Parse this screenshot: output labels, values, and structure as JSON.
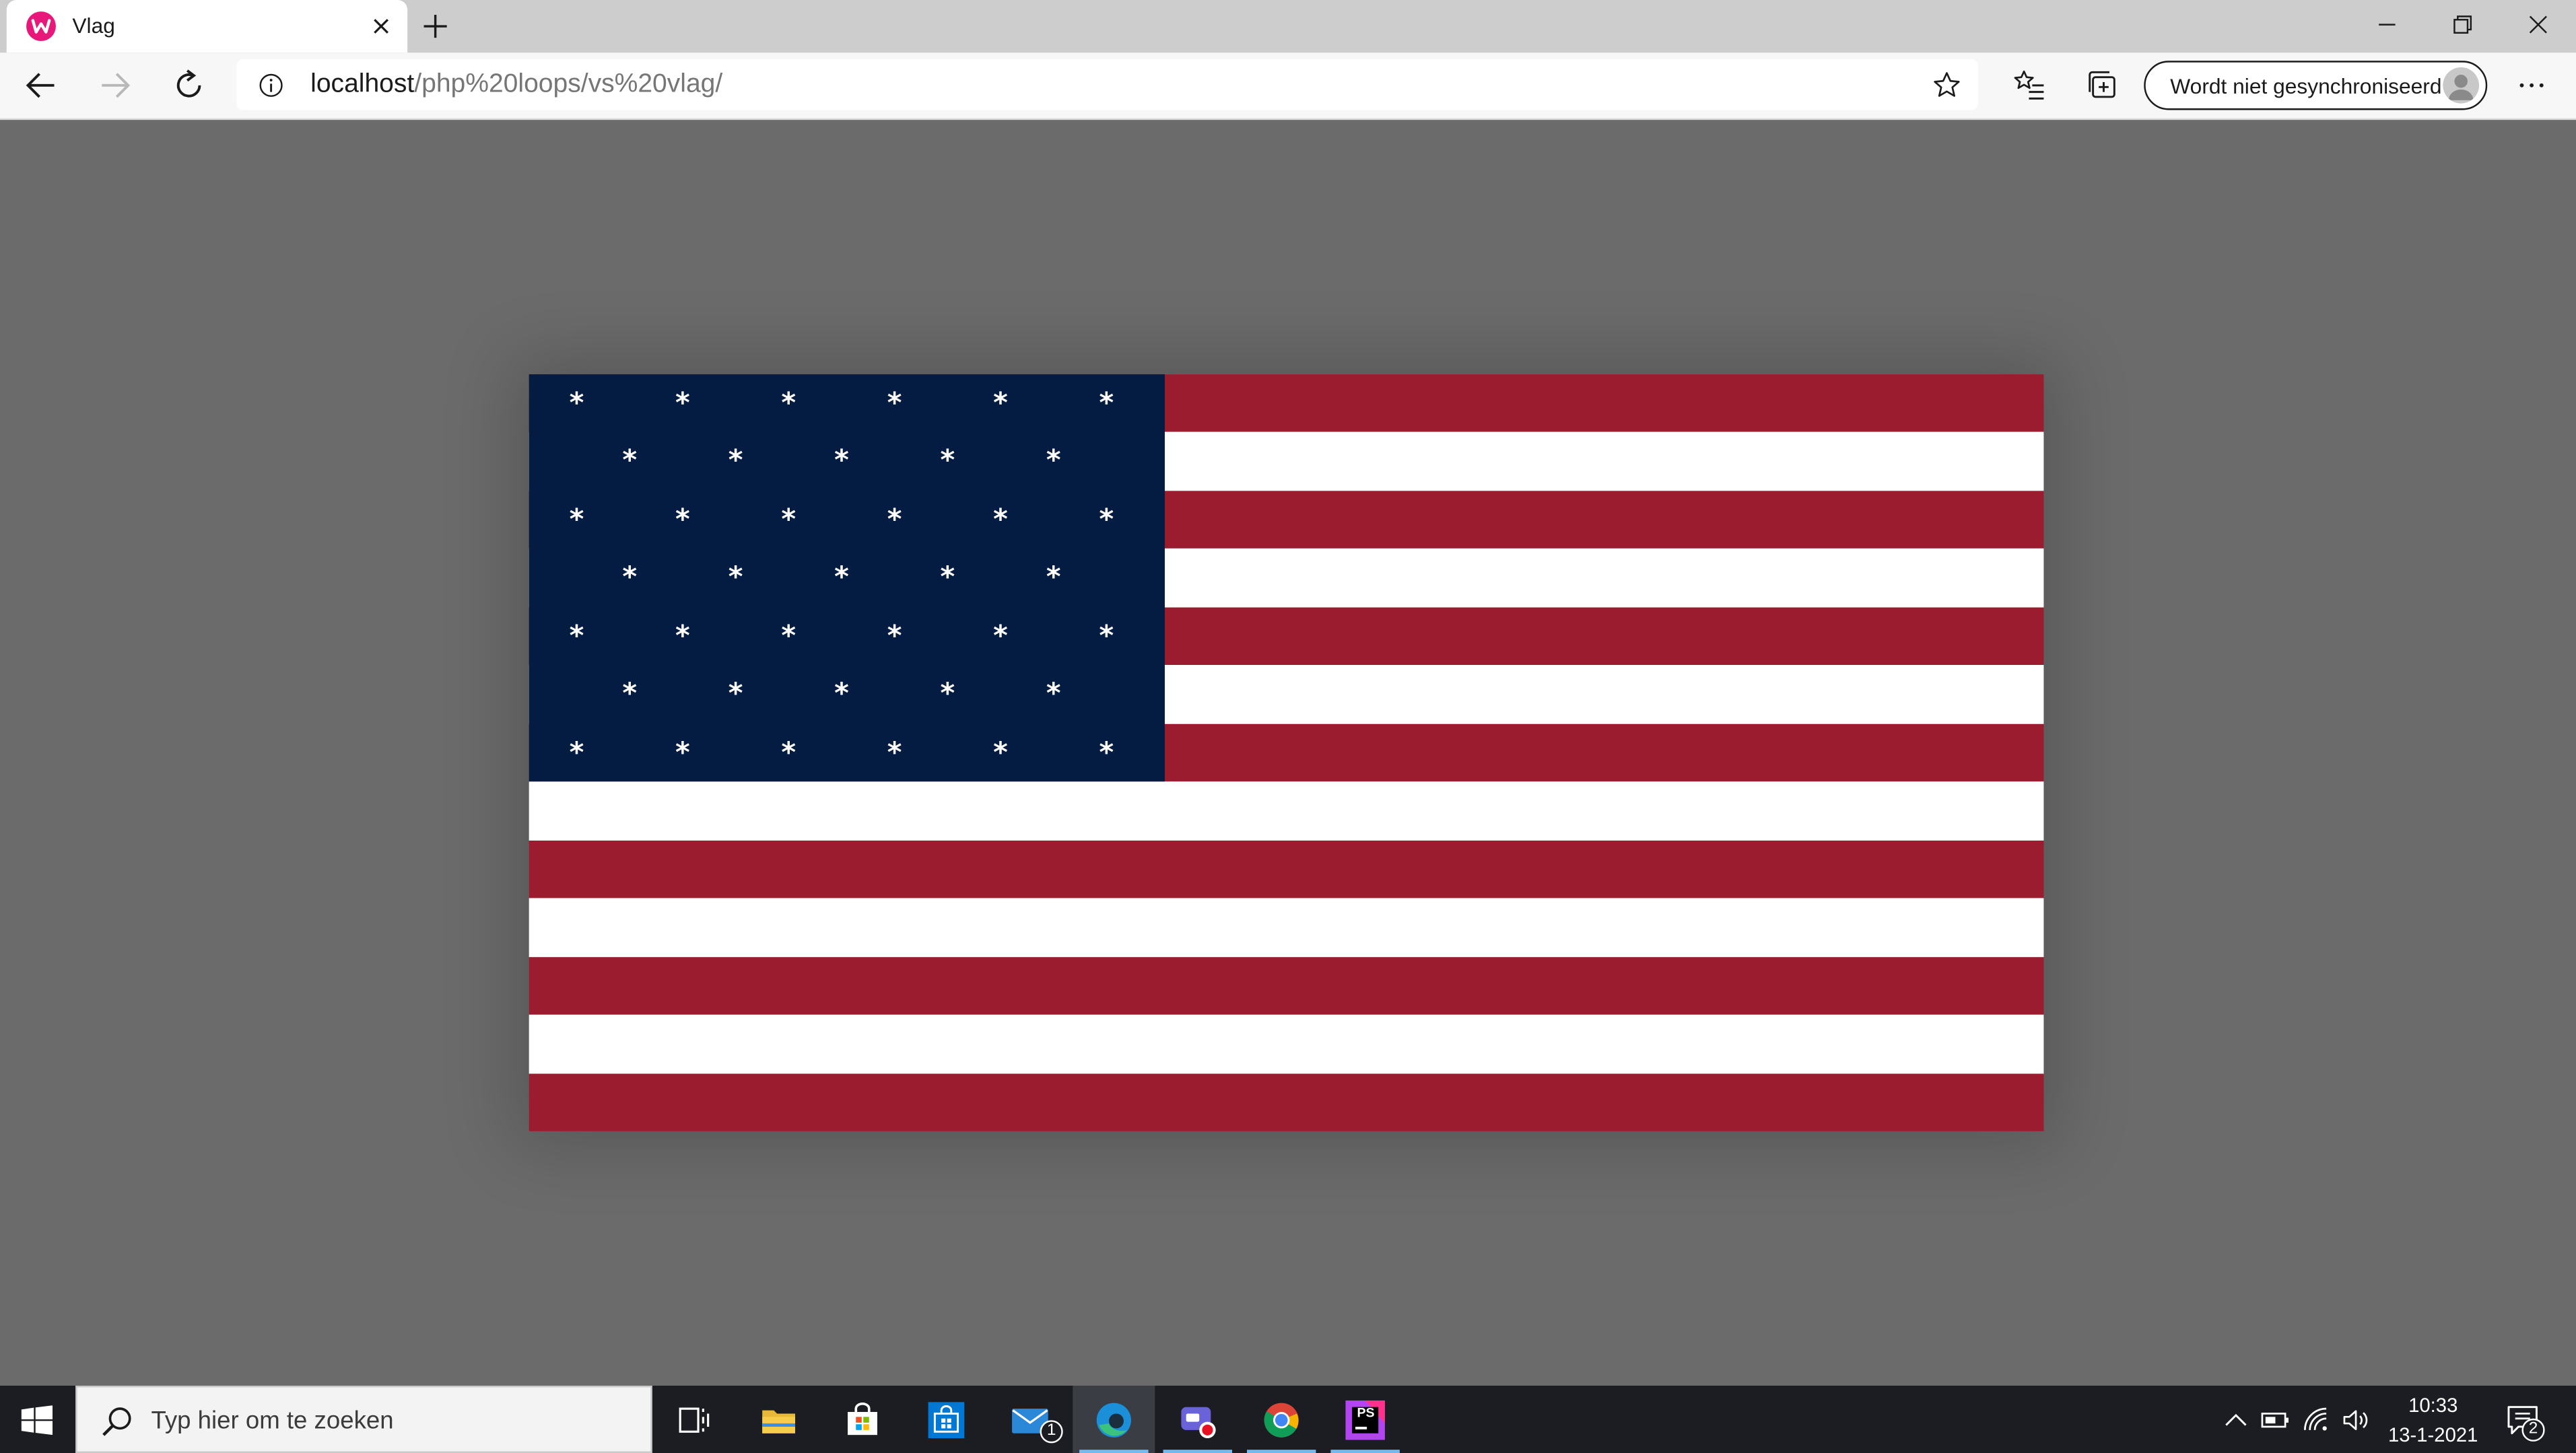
{
  "browser": {
    "tab": {
      "title": "Vlag",
      "favicon": "wampserver-icon"
    },
    "url": {
      "host": "localhost",
      "path": "/php%20loops/vs%20vlag/"
    },
    "profile": {
      "label": "Wordt niet gesynchroniseerd"
    }
  },
  "flag": {
    "stripe_count": 13,
    "canton_stripes": 7,
    "star_rows": [
      6,
      5,
      6,
      5,
      6,
      5,
      6
    ],
    "star_glyph": "*",
    "colors": {
      "red": "#9b1c2e",
      "white": "#ffffff",
      "blue": "#041c41"
    }
  },
  "taskbar": {
    "search_placeholder": "Typ hier om te zoeken",
    "mail_badge": "1",
    "apps": [
      "task-view",
      "file-explorer",
      "microsoft-store",
      "store-alt",
      "mail",
      "edge",
      "game-recorder",
      "chrome",
      "phpstorm"
    ],
    "clock": {
      "time": "10:33",
      "date": "13-1-2021"
    },
    "notification_count": "2"
  }
}
